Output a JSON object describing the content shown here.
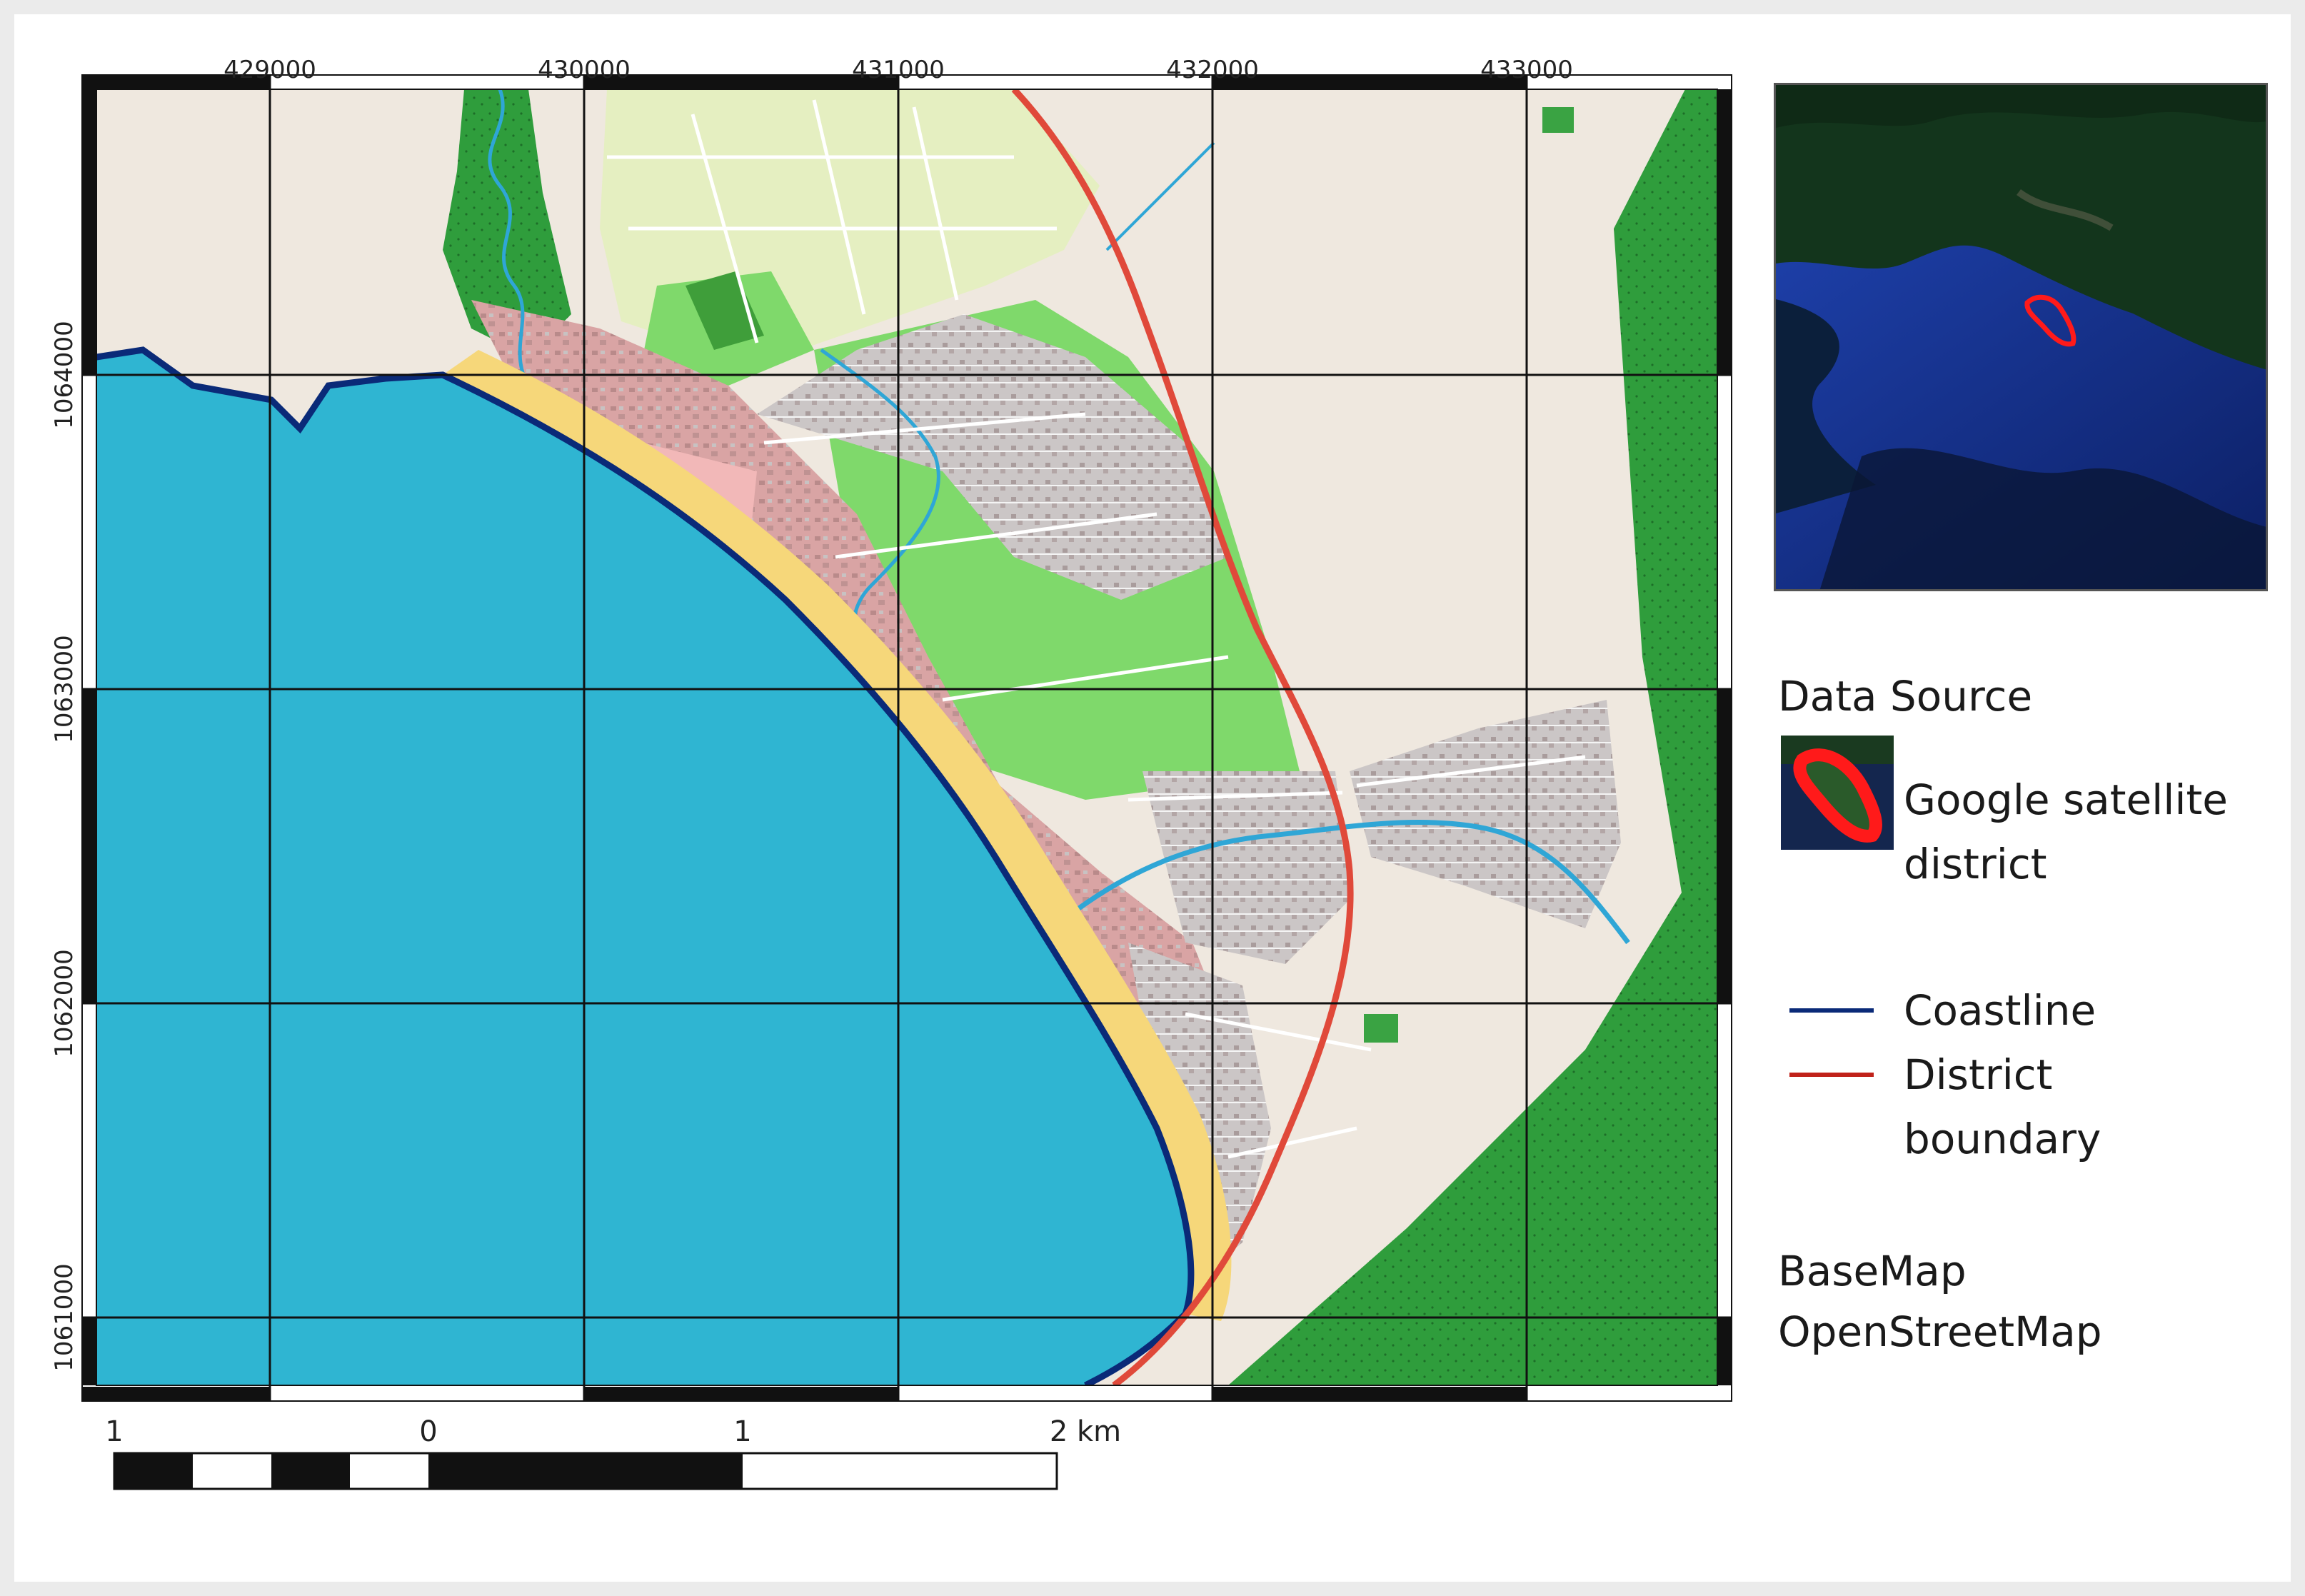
{
  "grid": {
    "eastings": [
      "429000",
      "430000",
      "431000",
      "432000",
      "433000"
    ],
    "northings": [
      "1064000",
      "1063000",
      "1062000",
      "1061000"
    ]
  },
  "scalebar": {
    "labels": [
      "1",
      "0",
      "1",
      "2 km"
    ]
  },
  "legend": {
    "data_source_title": "Data Source",
    "satellite_label_line1": "Google satellite",
    "satellite_label_line2": "district",
    "coastline_label": "Coastline",
    "boundary_label_line1": "District",
    "boundary_label_line2": "boundary",
    "basemap_line1": "BaseMap",
    "basemap_line2": "OpenStreetMap"
  },
  "colors": {
    "sea": "#2fb5d2",
    "coastline": "#0a2a78",
    "district_boundary": "#e0493a",
    "beach": "#f6d77a",
    "land": "#efe8df",
    "forest": "#2f9d3c",
    "park": "#7ed86a",
    "urban": "#e8a8a8",
    "built": "#c8c4c4",
    "residential": "#e4eec0",
    "river": "#2fa6d6",
    "inset_highlight": "#ff1a1a"
  },
  "icons": {
    "satellite_swatch": "satellite-thumbnail-icon",
    "coastline_swatch": "blue-line-icon",
    "boundary_swatch": "red-line-icon"
  }
}
